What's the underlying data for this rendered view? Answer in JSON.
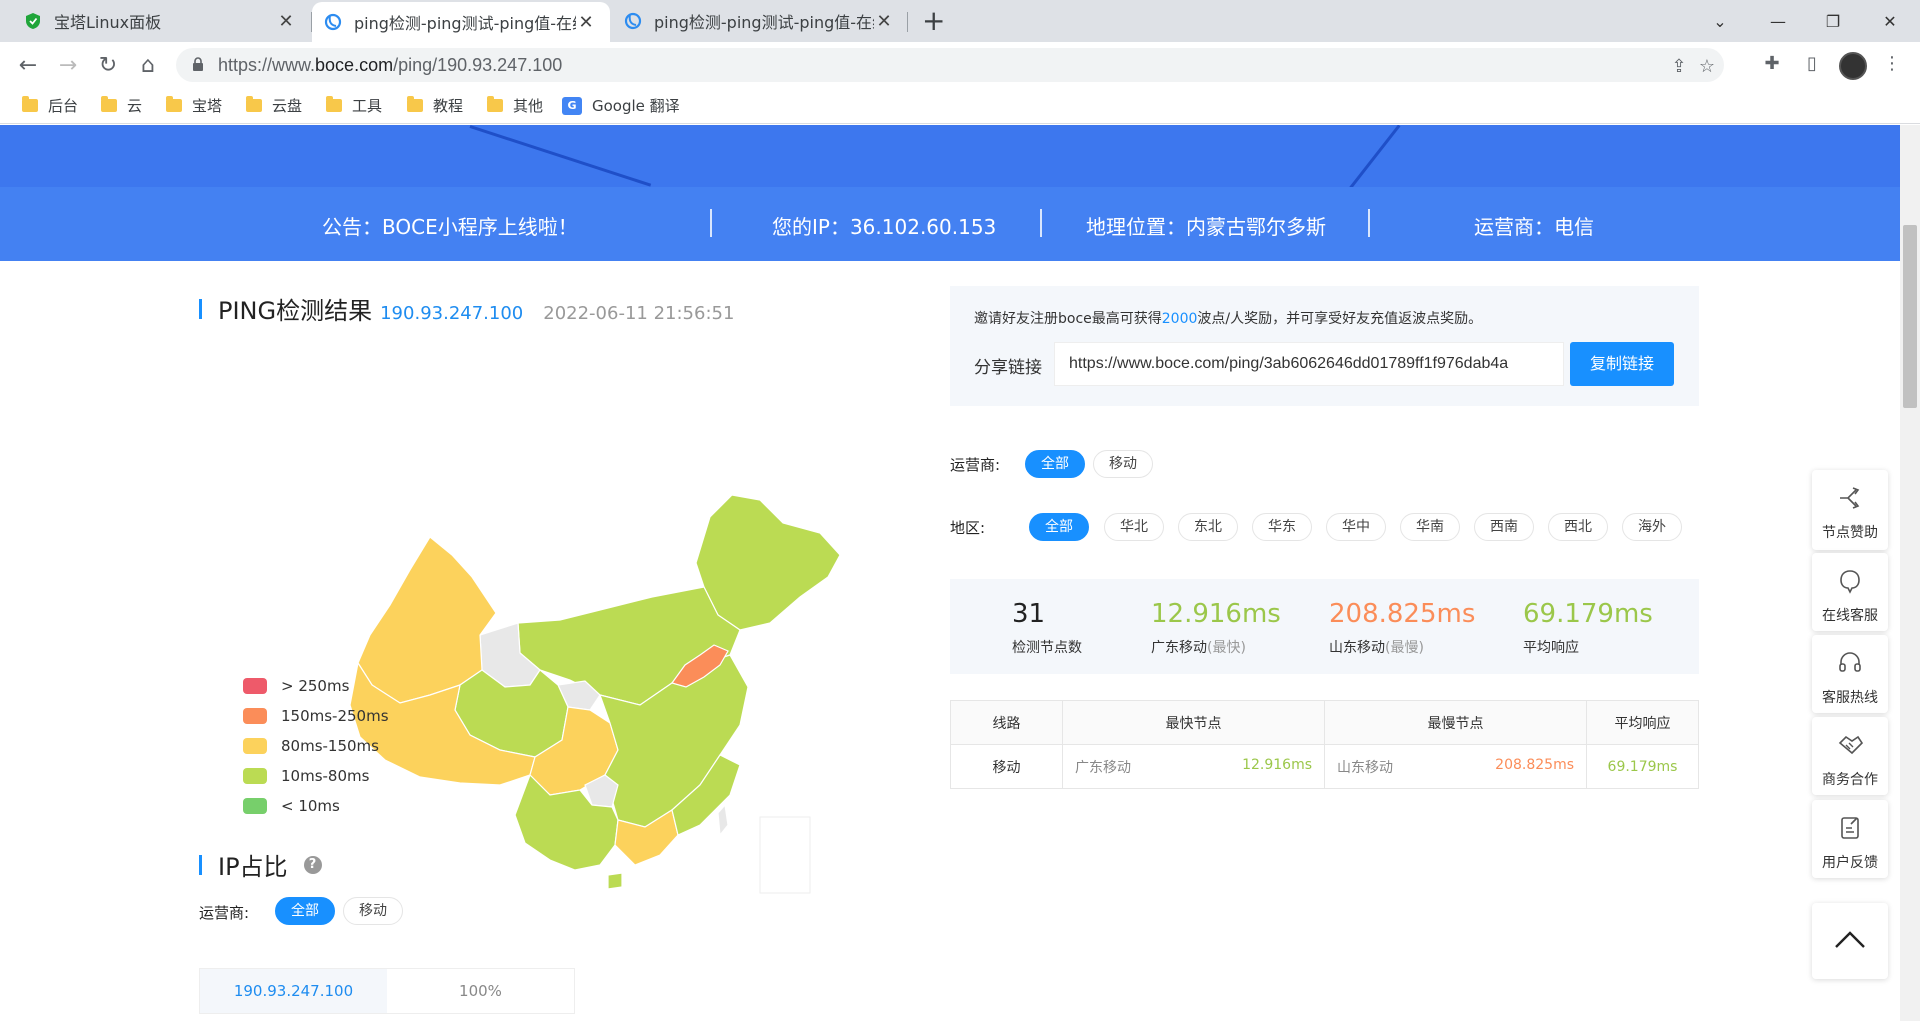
{
  "browser": {
    "tabs": [
      {
        "title": "宝塔Linux面板",
        "active": false
      },
      {
        "title": "ping检测-ping测试-ping值-在线",
        "active": true
      },
      {
        "title": "ping检测-ping测试-ping值-在线",
        "active": false
      }
    ],
    "url_prefix": "https://www.",
    "url_domain": "boce.com",
    "url_path": "/ping/190.93.247.100",
    "bookmarks": [
      {
        "label": "后台"
      },
      {
        "label": "云"
      },
      {
        "label": "宝塔"
      },
      {
        "label": "云盘"
      },
      {
        "label": "工具"
      },
      {
        "label": "教程"
      },
      {
        "label": "其他"
      }
    ],
    "google_translate": "Google 翻译"
  },
  "notice_bar": {
    "announcement": "公告：BOCE小程序上线啦！",
    "your_ip": "您的IP：36.102.60.153",
    "location": "地理位置：内蒙古鄂尔多斯",
    "isp": "运营商：电信"
  },
  "ping_section": {
    "title": "PING检测结果",
    "ip": "190.93.247.100",
    "datetime": "2022-06-11 21:56:51"
  },
  "legend": [
    {
      "label": "> 250ms",
      "color": "#ee5a6a"
    },
    {
      "label": "150ms-250ms",
      "color": "#fb8d59"
    },
    {
      "label": "80ms-150ms",
      "color": "#fcd25c"
    },
    {
      "label": "10ms-80ms",
      "color": "#bbdb53"
    },
    {
      "label": "< 10ms",
      "color": "#77cf6b"
    }
  ],
  "ip_share_section": {
    "title": "IP占比",
    "carrier_label": "运营商:",
    "pills": [
      "全部",
      "移动"
    ],
    "rows": [
      {
        "ip": "190.93.247.100",
        "pct": "100%"
      }
    ]
  },
  "invite": {
    "text_before": "邀请好友注册boce最高可获得",
    "highlight": "2000",
    "text_after": "波点/人奖励，并可享受好友充值返波点奖励。",
    "share_label": "分享链接",
    "share_link": "https://www.boce.com/ping/3ab6062646dd01789ff1f976dab4a",
    "copy_button": "复制链接"
  },
  "filters": {
    "carrier_label": "运营商:",
    "carrier_options": [
      "全部",
      "移动"
    ],
    "region_label": "地区:",
    "region_options": [
      "全部",
      "华北",
      "东北",
      "华东",
      "华中",
      "华南",
      "西南",
      "西北",
      "海外"
    ]
  },
  "stats": [
    {
      "value": "31",
      "label": "检测节点数",
      "sub": "",
      "color": "#222222"
    },
    {
      "value": "12.916ms",
      "label": "广东移动",
      "sub": "(最快)",
      "color": "#9bc74a"
    },
    {
      "value": "208.825ms",
      "label": "山东移动",
      "sub": "(最慢)",
      "color": "#fb8d59"
    },
    {
      "value": "69.179ms",
      "label": "平均响应",
      "sub": "",
      "color": "#9bc74a"
    }
  ],
  "results_table": {
    "headers": [
      "线路",
      "最快节点",
      "最慢节点",
      "平均响应"
    ],
    "rows": [
      {
        "line": "移动",
        "fast_node": "广东移动",
        "fast_val": "12.916ms",
        "slow_node": "山东移动",
        "slow_val": "208.825ms",
        "avg": "69.179ms"
      }
    ]
  },
  "side_float": [
    {
      "label": "节点赞助",
      "icon": "share-node-icon"
    },
    {
      "label": "在线客服",
      "icon": "chat-bubble-icon"
    },
    {
      "label": "客服热线",
      "icon": "headset-icon"
    },
    {
      "label": "商务合作",
      "icon": "handshake-icon"
    },
    {
      "label": "用户反馈",
      "icon": "feedback-edit-icon"
    }
  ],
  "map_colors": {
    "green": "#bbdb53",
    "yellow": "#fcd25c",
    "orange": "#fb8d59",
    "grey": "#e8e8e8"
  }
}
